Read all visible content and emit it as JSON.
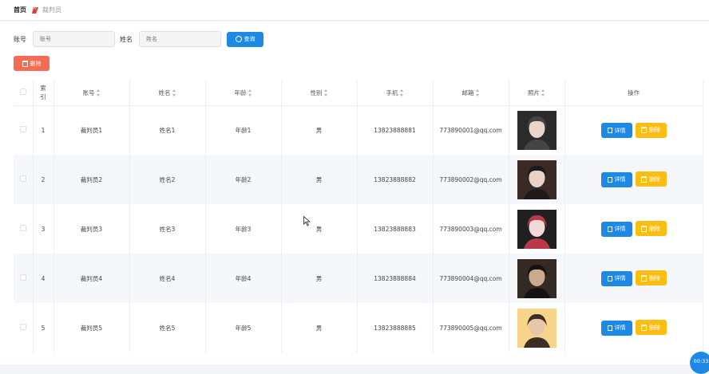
{
  "breadcrumb": {
    "home": "首页",
    "current": "裁判员"
  },
  "search": {
    "account_label": "账号",
    "account_placeholder": "账号",
    "name_label": "姓名",
    "name_placeholder": "姓名",
    "query_label": "查询"
  },
  "toolbar": {
    "batch_delete_label": "删除"
  },
  "table": {
    "headers": {
      "index": "索引",
      "account": "账号",
      "name": "姓名",
      "age": "年龄",
      "gender": "性别",
      "phone": "手机",
      "email": "邮箱",
      "photo": "照片",
      "actions": "操作"
    },
    "detail_label": "详情",
    "delete_label": "删除",
    "rows": [
      {
        "index": "1",
        "account": "裁判员1",
        "name": "姓名1",
        "age": "年龄1",
        "gender": "男",
        "phone": "13823888881",
        "email": "773890001@qq.com"
      },
      {
        "index": "2",
        "account": "裁判员2",
        "name": "姓名2",
        "age": "年龄2",
        "gender": "男",
        "phone": "13823888882",
        "email": "773890002@qq.com"
      },
      {
        "index": "3",
        "account": "裁判员3",
        "name": "姓名3",
        "age": "年龄3",
        "gender": "男",
        "phone": "13823888883",
        "email": "773890003@qq.com"
      },
      {
        "index": "4",
        "account": "裁判员4",
        "name": "姓名4",
        "age": "年龄4",
        "gender": "男",
        "phone": "13823888884",
        "email": "773890004@qq.com"
      },
      {
        "index": "5",
        "account": "裁判员5",
        "name": "姓名5",
        "age": "年龄5",
        "gender": "男",
        "phone": "13823888885",
        "email": "773890005@qq.com"
      }
    ]
  },
  "timer": "00:33",
  "colors": {
    "primary": "#1e88e5",
    "danger": "#f56c52",
    "warning": "#fbbd12"
  }
}
